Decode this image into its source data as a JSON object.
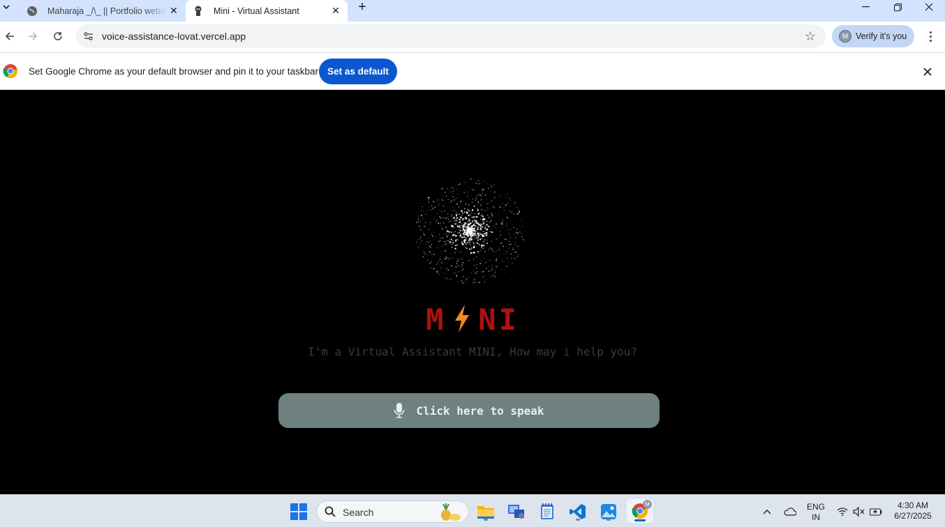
{
  "browser": {
    "tabs": [
      {
        "title": "Maharaja _/\\_ || Portfolio website",
        "favicon": "globe-icon",
        "active": false
      },
      {
        "title": "Mini - Virtual Assistant",
        "favicon": "robot-icon",
        "active": true
      }
    ],
    "new_tab": "+",
    "close_glyph": "✕",
    "url": "voice-assistance-lovat.vercel.app",
    "profile_button": "Verify it's you",
    "profile_initial": "M"
  },
  "infobar": {
    "message": "Set Google Chrome as your default browser and pin it to your taskbar",
    "button": "Set as default"
  },
  "page": {
    "brand_left": "M",
    "brand_right": "NI",
    "tagline": "I'm a Virtual Assistant MINI, How may i help you?",
    "speak_button": "Click here to speak",
    "colors": {
      "brand": "#b01010",
      "bolt": "#f08a24",
      "button_bg": "#6e8080"
    }
  },
  "taskbar": {
    "search_placeholder": "Search",
    "pinned": [
      "start-icon",
      "file-explorer-icon",
      "remote-desktop-icon",
      "notepad-icon",
      "vscode-icon",
      "photos-icon",
      "chrome-icon"
    ],
    "language_line1": "ENG",
    "language_line2": "IN",
    "time": "4:30 AM",
    "date": "6/27/2025"
  }
}
